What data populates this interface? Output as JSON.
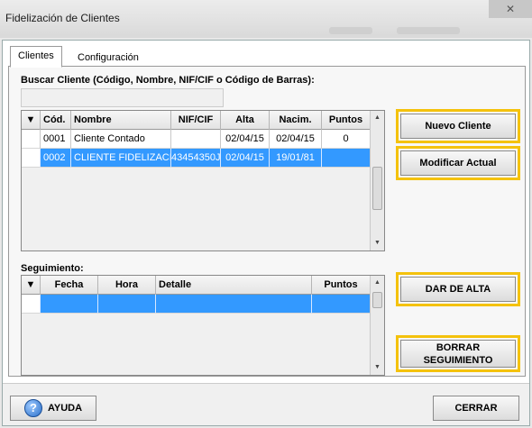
{
  "window": {
    "title": "Fidelización de Clientes",
    "close_glyph": "✕"
  },
  "tabs": [
    {
      "label": "Clientes",
      "active": true
    },
    {
      "label": "Configuración",
      "active": false
    }
  ],
  "search": {
    "label": "Buscar Cliente (Código, Nombre, NIF/CIF o Código de Barras):",
    "value": "",
    "placeholder": ""
  },
  "clients_table": {
    "columns": [
      "Cód.",
      "Nombre",
      "NIF/CIF",
      "Alta",
      "Nacim.",
      "Puntos"
    ],
    "rows": [
      {
        "indicator": "",
        "cod": "0001",
        "nombre": "Cliente Contado",
        "nif": "",
        "alta": "02/04/15",
        "nacim": "02/04/15",
        "puntos": "0",
        "selected": false
      },
      {
        "indicator": "▶",
        "cod": "0002",
        "nombre": "CLIENTE FIDELIZACI...",
        "nif": "43454350J",
        "alta": "02/04/15",
        "nacim": "19/01/81",
        "puntos": "",
        "selected": true
      }
    ]
  },
  "seguimiento": {
    "label": "Seguimiento:",
    "columns": [
      "Fecha",
      "Hora",
      "Detalle",
      "Puntos"
    ],
    "rows": [
      {
        "indicator": "▶",
        "fecha": "",
        "hora": "",
        "detalle": "",
        "puntos": "",
        "selected": true
      }
    ]
  },
  "buttons": {
    "nuevo_cliente": "Nuevo Cliente",
    "modificar_actual": "Modificar Actual",
    "dar_de_alta": "DAR DE ALTA",
    "borrar_line1": "BORRAR",
    "borrar_line2": "SEGUIMIENTO",
    "ayuda": "AYUDA",
    "cerrar": "CERRAR"
  },
  "icons": {
    "help": "?",
    "sort_down": "▼",
    "scroll_up": "▲",
    "scroll_down": "▼"
  },
  "colors": {
    "highlight": "#f4c20d",
    "selection": "#3399ff"
  }
}
